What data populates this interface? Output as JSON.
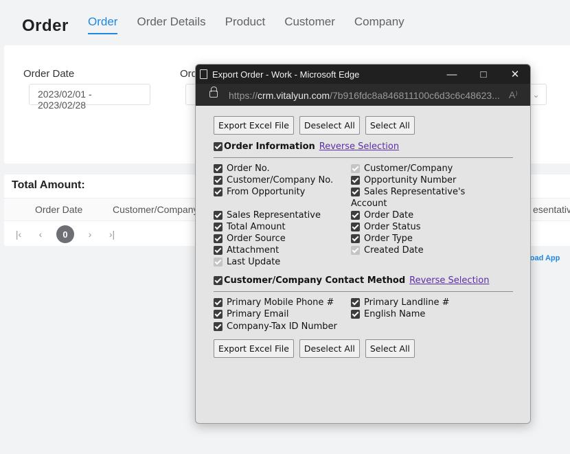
{
  "page": {
    "title": "Order",
    "tabs": [
      "Order",
      "Order Details",
      "Product",
      "Customer",
      "Company"
    ],
    "filter": {
      "order_date_label": "Order Date",
      "order_date_value": "2023/02/01 - 2023/02/28",
      "second_label_partial": "Ord"
    },
    "result": {
      "total_amount_label": "Total Amount:",
      "columns": [
        "Order Date",
        "Customer/Company",
        "esentative"
      ],
      "page_number": "0"
    },
    "download_link_partial": "nload App"
  },
  "popup": {
    "window_title": "Export Order - Work - Microsoft Edge",
    "url_prefix": "https://",
    "url_host": "crm.vitalyun.com",
    "url_path": "/7b916fdc8a846811100c6d3c6c48623...",
    "read_aloud": "A⁾",
    "buttons": {
      "export": "Export Excel File",
      "deselect": "Deselect All",
      "select": "Select All"
    },
    "sections": [
      {
        "title": "Order Information",
        "reverse_label": "Reverse Selection",
        "checked": true,
        "left": [
          {
            "label": "Order No.",
            "checked": true,
            "disabled": false
          },
          {
            "label": "Customer/Company No.",
            "checked": true,
            "disabled": false
          },
          {
            "label": "From Opportunity",
            "checked": true,
            "disabled": false
          },
          {
            "label": "Sales Representative",
            "checked": true,
            "disabled": false
          },
          {
            "label": "Total Amount",
            "checked": true,
            "disabled": false
          },
          {
            "label": "Order Source",
            "checked": true,
            "disabled": false
          },
          {
            "label": "Attachment",
            "checked": true,
            "disabled": false
          },
          {
            "label": "Last Update",
            "checked": true,
            "disabled": true
          }
        ],
        "right": [
          {
            "label": "Customer/Company",
            "checked": true,
            "disabled": true
          },
          {
            "label": "Opportunity Number",
            "checked": true,
            "disabled": false
          },
          {
            "label": "Sales Representative's",
            "label2": "Account",
            "checked": true,
            "disabled": false
          },
          {
            "label": "Order Date",
            "checked": true,
            "disabled": false
          },
          {
            "label": "Order Status",
            "checked": true,
            "disabled": false
          },
          {
            "label": "Order Type",
            "checked": true,
            "disabled": false
          },
          {
            "label": "Created Date",
            "checked": true,
            "disabled": true
          }
        ]
      },
      {
        "title": "Customer/Company Contact Method",
        "reverse_label": "Reverse Selection",
        "checked": true,
        "left": [
          {
            "label": "Primary Mobile Phone #",
            "checked": true,
            "disabled": false
          },
          {
            "label": "Primary Email",
            "checked": true,
            "disabled": false
          },
          {
            "label": "Company-Tax ID Number",
            "checked": true,
            "disabled": false
          }
        ],
        "right": [
          {
            "label": "Primary Landline #",
            "checked": true,
            "disabled": false
          },
          {
            "label": "English Name",
            "checked": true,
            "disabled": false
          }
        ]
      }
    ]
  }
}
